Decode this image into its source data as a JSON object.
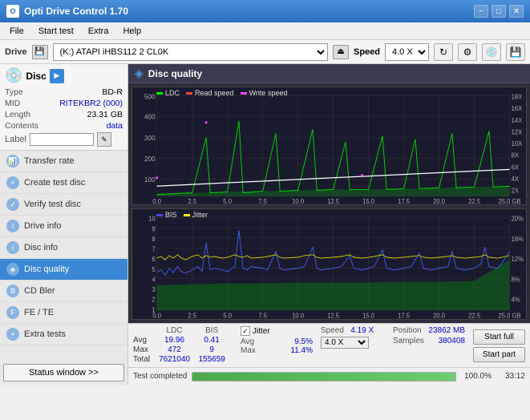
{
  "app": {
    "title": "Opti Drive Control 1.70",
    "icon": "O"
  },
  "titlebar": {
    "controls": {
      "minimize": "−",
      "maximize": "□",
      "close": "✕"
    }
  },
  "menubar": {
    "items": [
      "File",
      "Start test",
      "Extra",
      "Help"
    ]
  },
  "drivebar": {
    "label": "Drive",
    "drive_value": "(K:)  ATAPI iHBS112  2 CL0K",
    "speed_label": "Speed",
    "speed_value": "4.0 X"
  },
  "disc": {
    "title": "Disc",
    "type_label": "Type",
    "type_value": "BD-R",
    "mid_label": "MID",
    "mid_value": "RITEKBR2 (000)",
    "length_label": "Length",
    "length_value": "23.31 GB",
    "contents_label": "Contents",
    "contents_value": "data",
    "label_label": "Label",
    "label_value": ""
  },
  "nav": {
    "items": [
      {
        "id": "transfer-rate",
        "label": "Transfer rate"
      },
      {
        "id": "create-test-disc",
        "label": "Create test disc"
      },
      {
        "id": "verify-test-disc",
        "label": "Verify test disc"
      },
      {
        "id": "drive-info",
        "label": "Drive info"
      },
      {
        "id": "disc-info",
        "label": "Disc info"
      },
      {
        "id": "disc-quality",
        "label": "Disc quality",
        "active": true
      },
      {
        "id": "cd-bler",
        "label": "CD Bler"
      },
      {
        "id": "fe-te",
        "label": "FE / TE"
      },
      {
        "id": "extra-tests",
        "label": "Extra tests"
      }
    ],
    "status_btn": "Status window >>"
  },
  "disc_quality": {
    "title": "Disc quality",
    "chart1": {
      "legend": [
        {
          "id": "ldc",
          "label": "LDC"
        },
        {
          "id": "read",
          "label": "Read speed"
        },
        {
          "id": "write",
          "label": "Write speed"
        }
      ],
      "y_labels": [
        "500",
        "400",
        "300",
        "200",
        "100"
      ],
      "y_labels_right": [
        "18X",
        "16X",
        "14X",
        "12X",
        "10X",
        "8X",
        "6X",
        "4X",
        "2X"
      ],
      "x_labels": [
        "0.0",
        "2.5",
        "5.0",
        "7.5",
        "10.0",
        "12.5",
        "15.0",
        "17.5",
        "20.0",
        "22.5",
        "25.0 GB"
      ]
    },
    "chart2": {
      "legend": [
        {
          "id": "bis",
          "label": "BIS"
        },
        {
          "id": "jitter",
          "label": "Jitter"
        }
      ],
      "y_labels": [
        "10",
        "9",
        "8",
        "7",
        "6",
        "5",
        "4",
        "3",
        "2",
        "1"
      ],
      "y_labels_right": [
        "20%",
        "16%",
        "12%",
        "8%",
        "4%"
      ],
      "x_labels": [
        "0.0",
        "2.5",
        "5.0",
        "7.5",
        "10.0",
        "12.5",
        "15.0",
        "17.5",
        "20.0",
        "22.5",
        "25.0 GB"
      ]
    }
  },
  "stats": {
    "headers": [
      "LDC",
      "BIS"
    ],
    "rows": [
      {
        "label": "Avg",
        "ldc": "19.96",
        "bis": "0.41"
      },
      {
        "label": "Max",
        "ldc": "472",
        "bis": "9"
      },
      {
        "label": "Total",
        "ldc": "7621040",
        "bis": "155659"
      }
    ],
    "jitter": {
      "label": "Jitter",
      "checked": true,
      "avg": "9.5%",
      "max": "11.4%"
    },
    "speed": {
      "label": "Speed",
      "value": "4.19 X",
      "target": "4.0 X"
    },
    "position": {
      "label": "Position",
      "value": "23862 MB",
      "samples_label": "Samples",
      "samples_value": "380408"
    },
    "buttons": {
      "start_full": "Start full",
      "start_part": "Start part"
    }
  },
  "progress": {
    "label": "Test completed",
    "percent": 100.0,
    "percent_display": "100.0%",
    "time": "33:12"
  }
}
